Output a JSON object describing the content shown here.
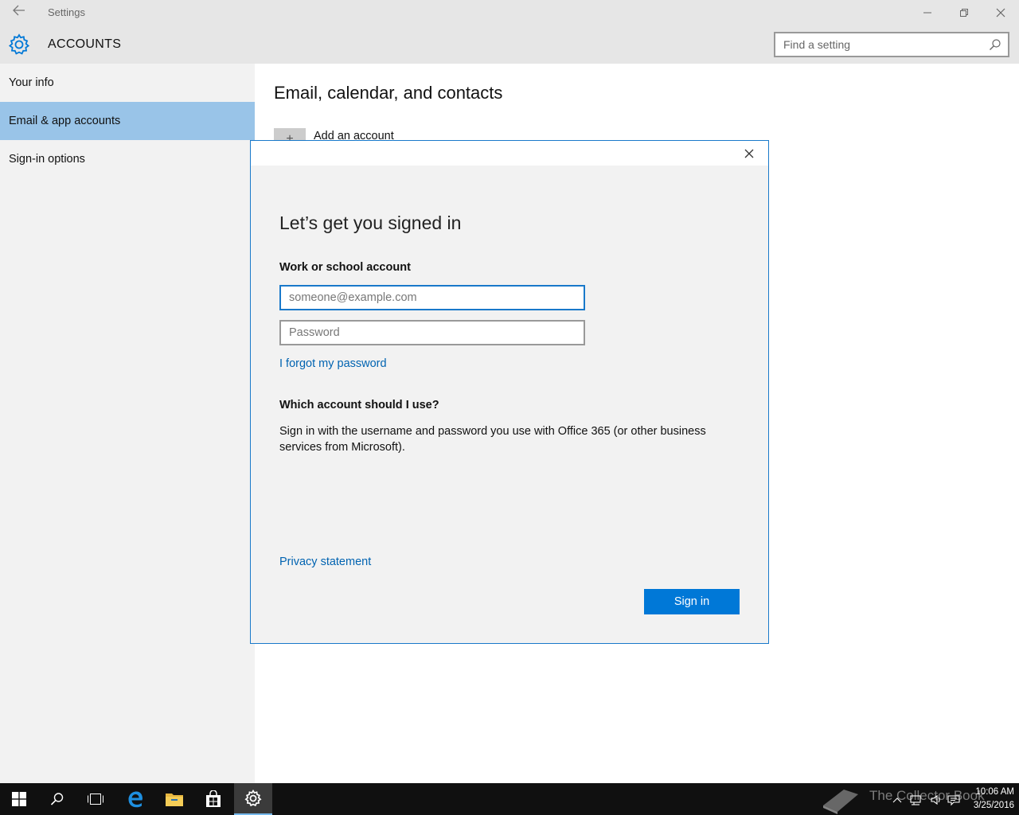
{
  "window": {
    "title": "Settings",
    "section_title": "ACCOUNTS",
    "search_placeholder": "Find a setting"
  },
  "sidebar": {
    "items": [
      {
        "label": "Your info",
        "selected": false
      },
      {
        "label": "Email & app accounts",
        "selected": true
      },
      {
        "label": "Sign-in options",
        "selected": false
      }
    ]
  },
  "main": {
    "heading": "Email, calendar, and contacts",
    "add_account_label": "Add an account",
    "add_account_icon": "+"
  },
  "dialog": {
    "title": "Let’s get you signed in",
    "account_label": "Work or school account",
    "email_placeholder": "someone@example.com",
    "password_placeholder": "Password",
    "forgot_link": "I forgot my password",
    "question": "Which account should I use?",
    "explanation": "Sign in with the username and password you use with Office 365 (or other business services from Microsoft).",
    "privacy_link": "Privacy statement",
    "signin_button": "Sign in"
  },
  "taskbar": {
    "icons": [
      "start-icon",
      "search-icon",
      "task-view-icon",
      "edge-icon",
      "file-explorer-icon",
      "store-icon",
      "settings-icon"
    ],
    "watermark": "The Collector Book",
    "time": "10:06 AM",
    "date": "3/25/2016"
  },
  "colors": {
    "accent": "#0078d7",
    "selected_nav": "#99c4e8",
    "link": "#0063b1",
    "dialog_border": "#1979ca"
  }
}
